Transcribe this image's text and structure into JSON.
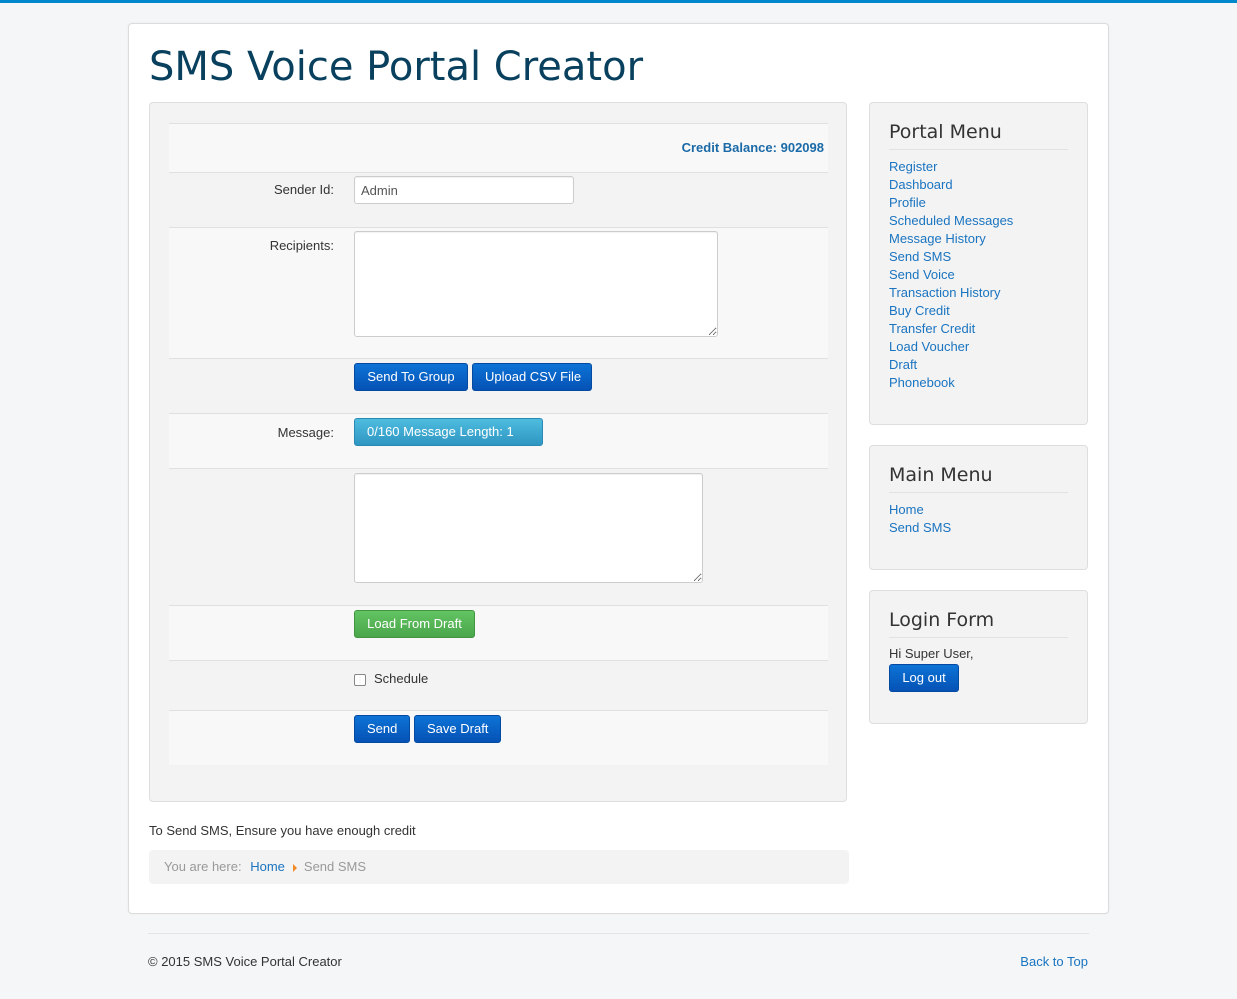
{
  "site": {
    "title": "SMS Voice Portal Creator"
  },
  "form": {
    "credit_label": "Credit Balance:",
    "credit_value": "902098",
    "sender_label": "Sender Id:",
    "sender_value": "Admin",
    "recipients_label": "Recipients:",
    "send_to_group_label": "Send To Group",
    "upload_csv_label": "Upload CSV File",
    "message_label": "Message:",
    "message_counter": "0/160 Message Length: 1",
    "load_draft_label": "Load From Draft",
    "schedule_label": "Schedule",
    "send_label": "Send",
    "save_draft_label": "Save Draft"
  },
  "note": "To Send SMS, Ensure you have enough credit",
  "breadcrumb": {
    "prefix": "You are here:",
    "home": "Home",
    "current": "Send SMS"
  },
  "portal_menu": {
    "title": "Portal Menu",
    "items": [
      "Register",
      "Dashboard",
      "Profile",
      "Scheduled Messages",
      "Message History",
      "Send SMS",
      "Send Voice",
      "Transaction History",
      "Buy Credit",
      "Transfer Credit",
      "Load Voucher",
      "Draft",
      "Phonebook"
    ]
  },
  "main_menu": {
    "title": "Main Menu",
    "items": [
      "Home",
      "Send SMS"
    ]
  },
  "login_form": {
    "title": "Login Form",
    "greeting": "Hi Super User,",
    "logout_label": "Log out"
  },
  "footer": {
    "copyright": "© 2015 SMS Voice Portal Creator",
    "back_to_top": "Back to Top"
  },
  "colors": {
    "accent": "#0088cc",
    "primary_button": "#0552b5",
    "info_button": "#2f96c2",
    "success_button": "#4ba64b",
    "title": "#08405e",
    "link": "#1a74c0"
  }
}
